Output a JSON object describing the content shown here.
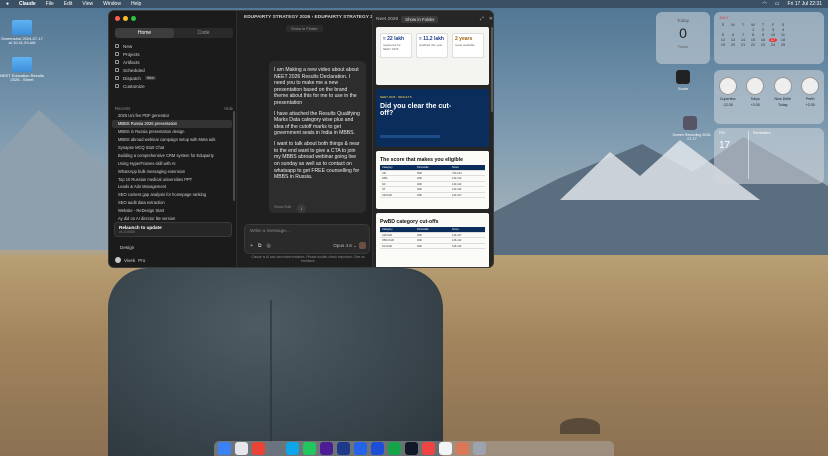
{
  "menubar": {
    "app": "Claude",
    "items": [
      "File",
      "Edit",
      "View",
      "Window",
      "Help"
    ],
    "clock": "Fri 17 Jul  22:31"
  },
  "desktop_icons": [
    {
      "label": "Screenshot 2024-07-17 at 10.41.03 AM"
    },
    {
      "label": "NEET Education Results 2026 - Sheet"
    }
  ],
  "sidebar": {
    "tabs": [
      "Home",
      "Code"
    ],
    "nav": [
      {
        "label": "New",
        "icon": "plus-icon"
      },
      {
        "label": "Projects",
        "icon": "folder-icon"
      },
      {
        "label": "Artifacts",
        "icon": "artifact-icon"
      },
      {
        "label": "Scheduled",
        "icon": "clock-icon"
      },
      {
        "label": "Dispatch",
        "icon": "dispatch-icon",
        "badge": "New"
      },
      {
        "label": "Customize",
        "icon": "customize-icon"
      }
    ],
    "recents_title": "Recents",
    "recents_action": "Hide",
    "recents": [
      "2026 Uni fee PDF generator",
      "MBBS Russia 2026 presentation",
      "MBBS in Russia presentation design",
      "MBBS abroad webinar campaign setup with Meta ads",
      "Synapse MCQ Start Chat",
      "Building a comprehensive CRM system for Edupairty",
      "Using HyperFrames skill with AI",
      "WhatsApp bulk messaging extension",
      "Top 10 Russian medical universities PPT",
      "Leads & Ads Management",
      "SEO content gap analysis for homepage ranking",
      "SEO audit data extraction",
      "Website - ReDesign Start",
      "Ay did on AI director lite version"
    ],
    "selected_index": 1,
    "relaunch_title": "Relaunch to update",
    "relaunch_version": "v1.0.0000",
    "design_label": "Design",
    "user_name": "Vivek",
    "user_plan": "Pro"
  },
  "chat": {
    "title": "EDUPAIRTY STRATEGY 2026  ›  EDUPAIRTY STRATEGY 2026",
    "chip": "Show in Finder",
    "message_paragraphs": [
      "I am Making a new video about about NEET 2026 Results Declaration. I need you to make me a new presentation based on the brand theme about this for me to use in the presentation",
      "I have attached the Results Qualifying Marks Data category wise plus and idea of the cutoff marks to get government seats in India in MBBS.",
      "I want to talk about both things & near to the end want to give a CTA to join my MBBS abroad webinar going live on sunday as well as to contact on whatsapp to get FREE counselling for MBBS in Russia."
    ],
    "edit_label": "Show Edit",
    "download_glyph": "↓",
    "composer_placeholder": "Write a message...",
    "composer_tools": [
      "+",
      "⧉",
      "◎"
    ],
    "model_label": "Opus 4.6 ⌄",
    "disclaimer": "Claude is AI and can make mistakes. Please double-check important. Give us feedback"
  },
  "artifact": {
    "title": "Neet 2026",
    "show_in_folder": "Show in Folder",
    "slides": {
      "s1_stats": [
        {
          "value": "≈ 22 lakh",
          "caption": "registered for NEET 2026"
        },
        {
          "value": "≈ 11.2 lakh",
          "caption": "qualified this year"
        },
        {
          "value": "2 years",
          "caption": "seats available",
          "gold": true
        }
      ],
      "s2_kicker": "NEET 2026 · RESULTS",
      "s2_heading": "Did you clear the cut-off?",
      "s3_heading": "The score that makes you eligible",
      "s3_headers": [
        "Category",
        "Percentile",
        "Score"
      ],
      "s3_rows": [
        [
          "UR",
          "50th",
          "720-144"
        ],
        [
          "OBC",
          "40th",
          "143-113"
        ],
        [
          "SC",
          "40th",
          "143-113"
        ],
        [
          "ST",
          "40th",
          "143-113"
        ],
        [
          "UR-PwD",
          "45th",
          "143-127"
        ]
      ],
      "s4_heading": "PwBD category cut-offs",
      "s4_headers": [
        "Category",
        "Percentile",
        "Score"
      ],
      "s4_rows": [
        [
          "UR-PwD",
          "45th",
          "143-127"
        ],
        [
          "OBC-PwD",
          "40th",
          "126-113"
        ],
        [
          "SC-PwD",
          "40th",
          "126-113"
        ]
      ]
    }
  },
  "widgets": {
    "today": {
      "label": "Today",
      "count": "0",
      "sub": "Focus"
    },
    "month": {
      "title": "JULY",
      "days": [
        "S",
        "M",
        "T",
        "W",
        "T",
        "F",
        "S",
        "",
        "",
        "",
        "1",
        "2",
        "3",
        "4",
        "5",
        "6",
        "7",
        "8",
        "9",
        "10",
        "11",
        "12",
        "13",
        "14",
        "15",
        "16",
        "17",
        "18",
        "19",
        "20",
        "21",
        "22",
        "23",
        "24",
        "25"
      ],
      "today": "17"
    },
    "clocks": [
      {
        "city": "Cupertino",
        "delta": "-12:30"
      },
      {
        "city": "Tokyo",
        "delta": "+3:30"
      },
      {
        "city": "New Delhi",
        "delta": "Today"
      },
      {
        "city": "Perth",
        "delta": "+2:30"
      }
    ],
    "reminder": {
      "day": "FRI",
      "num": "17",
      "title": "Reminders"
    },
    "app_icon_label": "Xcode",
    "screenshot_label": "Screen Recording 2026-07-17"
  },
  "colors": {
    "accent": "#6a4f45",
    "close": "#ff5f57",
    "minimize": "#febc2e",
    "zoom": "#28c840",
    "navy": "#0b2d5b"
  },
  "dock_apps": [
    "finder",
    "launchpad",
    "chrome",
    "settings",
    "safari",
    "whatsapp",
    "premiere",
    "photoshop",
    "zoom",
    "zoom-2",
    "sheets",
    "terminal",
    "music",
    "voice-memos",
    "claude",
    "trash"
  ]
}
